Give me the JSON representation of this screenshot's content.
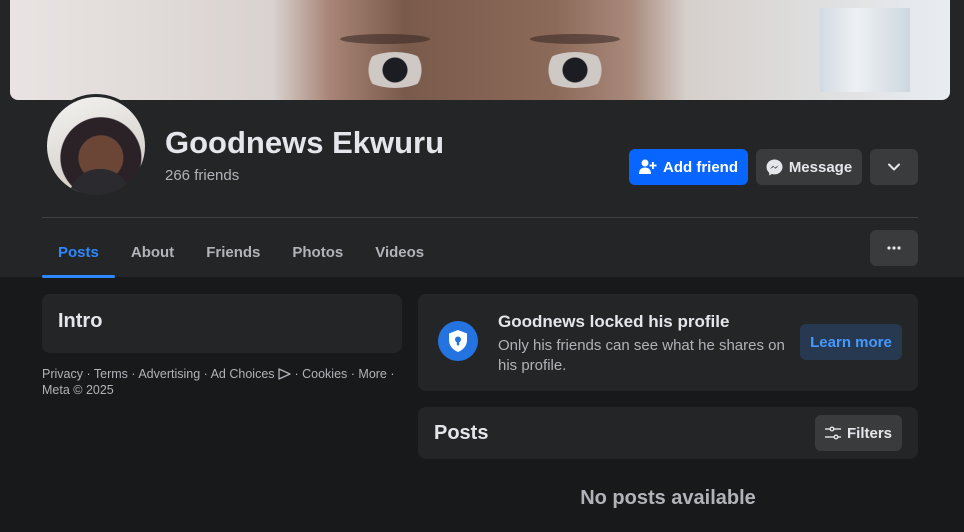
{
  "profile": {
    "name": "Goodnews Ekwuru",
    "friends_count": "266 friends"
  },
  "actions": {
    "add_friend": "Add friend",
    "message": "Message"
  },
  "tabs": [
    {
      "label": "Posts",
      "active": true
    },
    {
      "label": "About",
      "active": false
    },
    {
      "label": "Friends",
      "active": false
    },
    {
      "label": "Photos",
      "active": false
    },
    {
      "label": "Videos",
      "active": false
    }
  ],
  "intro": {
    "title": "Intro"
  },
  "footer": {
    "links": [
      "Privacy",
      "Terms",
      "Advertising",
      "Ad Choices",
      "Cookies",
      "More"
    ],
    "copyright": "Meta © 2025"
  },
  "locked_notice": {
    "title": "Goodnews locked his profile",
    "description": "Only his friends can see what he shares on his profile.",
    "button": "Learn more"
  },
  "posts": {
    "title": "Posts",
    "filters_label": "Filters",
    "empty_message": "No posts available"
  },
  "colors": {
    "background": "#18191a",
    "card": "#242526",
    "primary": "#0866ff",
    "active_tab": "#2d88ff"
  }
}
